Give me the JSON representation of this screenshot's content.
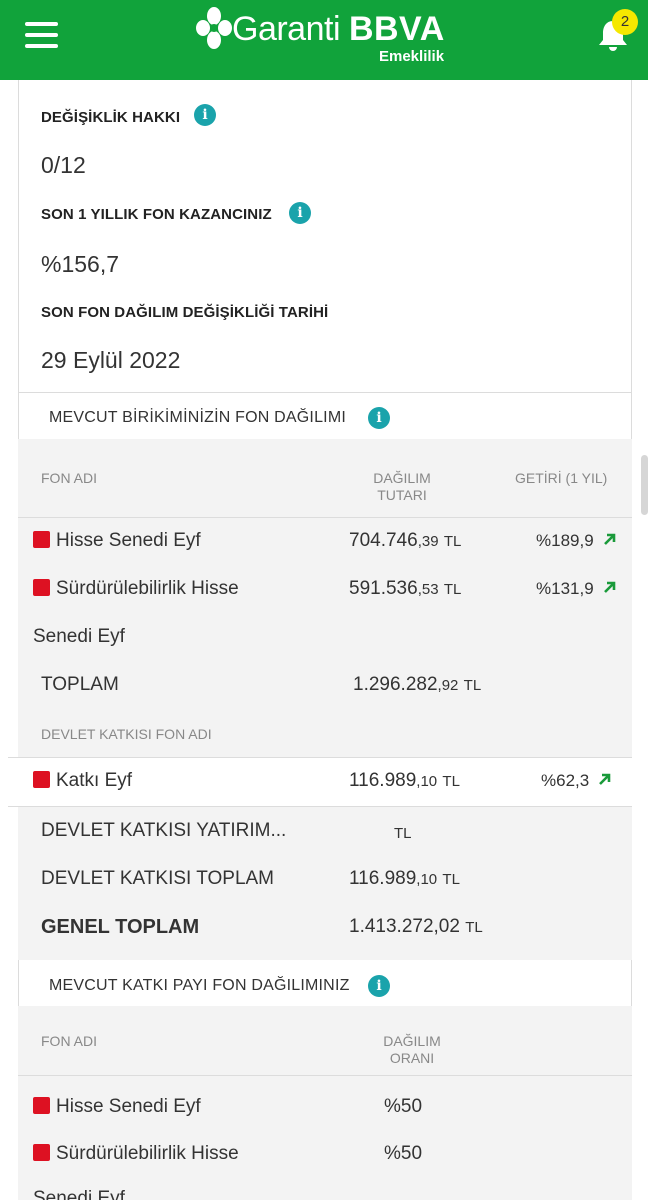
{
  "header": {
    "brand_name": "Garanti",
    "brand_bold": "BBVA",
    "brand_sub": "Emeklilik",
    "notification_count": "2",
    "bg_color": "#11a33b"
  },
  "summary": {
    "change_right_label": "DEĞİŞİKLİK HAKKI",
    "change_right_value": "0/12",
    "yearly_gain_label": "SON 1 YILLIK FON KAZANCINIZ",
    "yearly_gain_value": "%156,7",
    "last_change_label": "SON FON DAĞILIM DEĞİŞİKLİĞİ TARİHİ",
    "last_change_value": "29 Eylül 2022"
  },
  "savings": {
    "title": "MEVCUT BİRİKİMİNİZİN FON DAĞILIMI",
    "col_name": "FON ADI",
    "col_amount_l1": "DAĞILIM",
    "col_amount_l2": "TUTARI",
    "col_return": "GETİRİ (1 YIL)",
    "rows": [
      {
        "name": "Hisse Senedi Eyf",
        "amount_main": "704.746",
        "amount_dec": ",39",
        "currency": "TL",
        "return": "%189,9"
      },
      {
        "name": "Sürdürülebilirlik Hisse",
        "name_cont": "Senedi Eyf",
        "amount_main": "591.536",
        "amount_dec": ",53",
        "currency": "TL",
        "return": "%131,9"
      }
    ],
    "total_label": "TOPLAM",
    "total_main": "1.296.282",
    "total_dec": ",92",
    "total_currency": "TL",
    "state_header": "DEVLET KATKISI FON ADI",
    "state_row": {
      "name": "Katkı Eyf",
      "amount_main": "116.989",
      "amount_dec": ",10",
      "currency": "TL",
      "return": "%62,3"
    },
    "state_invest_label": "DEVLET KATKISI YATIRIM...",
    "state_invest_currency": "TL",
    "state_total_label": "DEVLET KATKISI TOPLAM",
    "state_total_main": "116.989",
    "state_total_dec": ",10",
    "state_total_currency": "TL",
    "grand_total_label": "GENEL TOPLAM",
    "grand_total_value": "1.413.272,02",
    "grand_total_currency": "TL"
  },
  "contribution": {
    "title": "MEVCUT KATKI PAYI FON DAĞILIMINIZ",
    "col_name": "FON ADI",
    "col_ratio_l1": "DAĞILIM",
    "col_ratio_l2": "ORANI",
    "rows": [
      {
        "name": "Hisse Senedi Eyf",
        "ratio": "%50"
      },
      {
        "name": "Sürdürülebilirlik Hisse",
        "name_cont": "Senedi Eyf",
        "ratio": "%50"
      }
    ]
  },
  "colors": {
    "brand_green": "#11a33b",
    "info_teal": "#1aa3ab",
    "fund_red": "#dd1122",
    "badge_yellow": "#f5e800",
    "up_arrow_green": "#1a9a3a"
  }
}
